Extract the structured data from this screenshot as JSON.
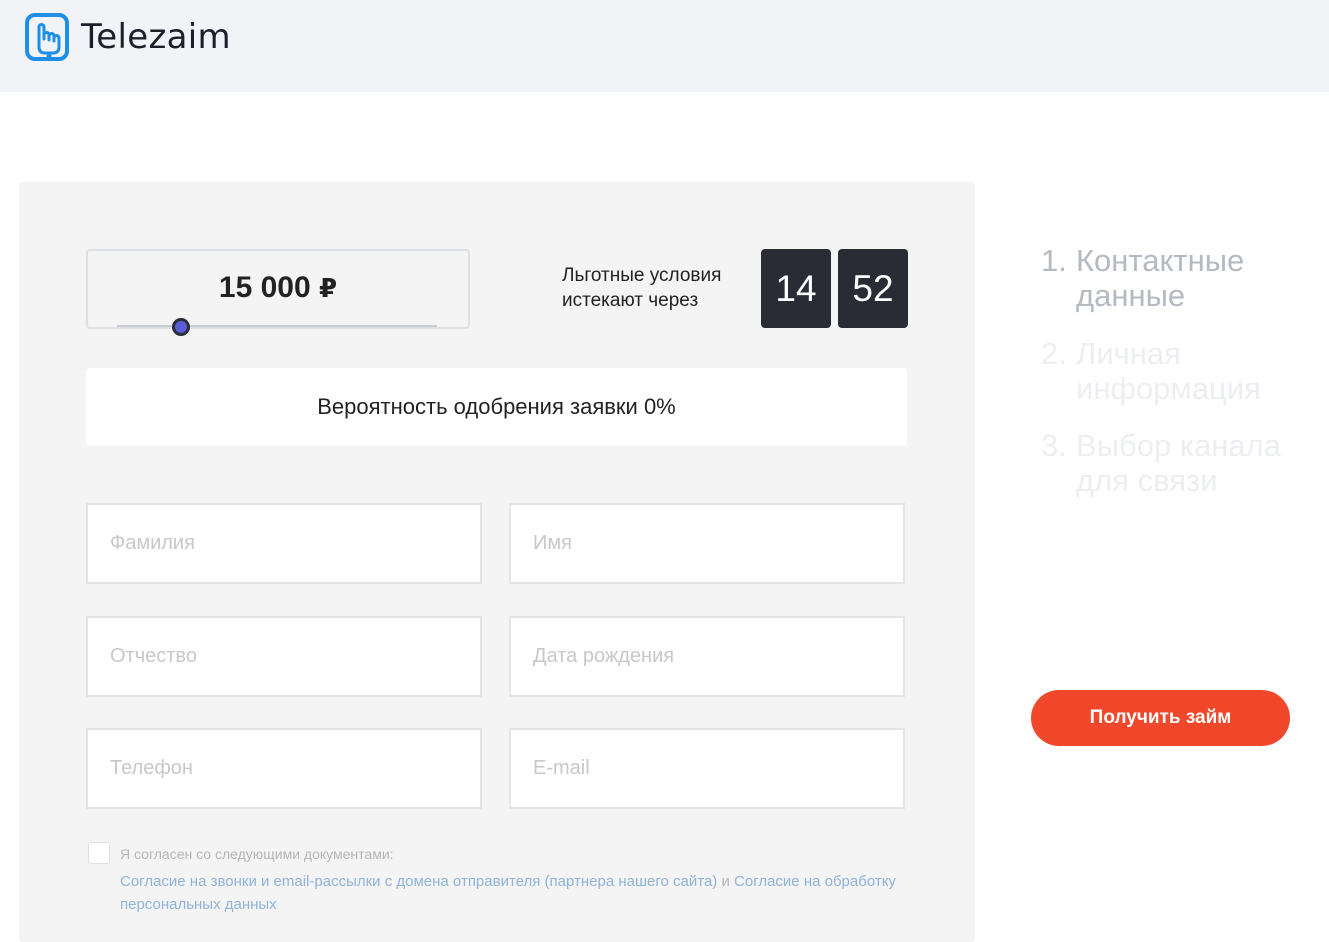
{
  "brand": {
    "name": "Telezaim",
    "color": "#1e8fe8"
  },
  "calculator": {
    "amount": "15 000",
    "currency": "₽",
    "slider_fraction": 0.2,
    "timer_label_line1": "Льготные условия",
    "timer_label_line2": "истекают через",
    "timer_minutes": "14",
    "timer_seconds": "52"
  },
  "approval": {
    "text": "Вероятность одобрения заявки 0%"
  },
  "form": {
    "lastname_placeholder": "Фамилия",
    "firstname_placeholder": "Имя",
    "patronymic_placeholder": "Отчество",
    "birthdate_placeholder": "Дата рождения",
    "phone_placeholder": "Телефон",
    "email_placeholder": "E-mail"
  },
  "consent": {
    "label": "Я согласен со следующими документами:",
    "link1": "Согласие на звонки и email-рассылки с домена отправителя (партнера нашего сайта)",
    "conjunction": " и ",
    "link2": "Согласие на обработку персональных данных"
  },
  "steps": [
    {
      "number": "1.",
      "line1": "Контактные",
      "line2": "данные",
      "state": "active"
    },
    {
      "number": "2.",
      "line1": "Личная",
      "line2": "информация",
      "state": "inactive"
    },
    {
      "number": "3.",
      "line1": "Выбор канала",
      "line2": "для связи",
      "state": "inactive"
    }
  ],
  "cta": {
    "label": "Получить займ",
    "color": "#f1472b"
  }
}
